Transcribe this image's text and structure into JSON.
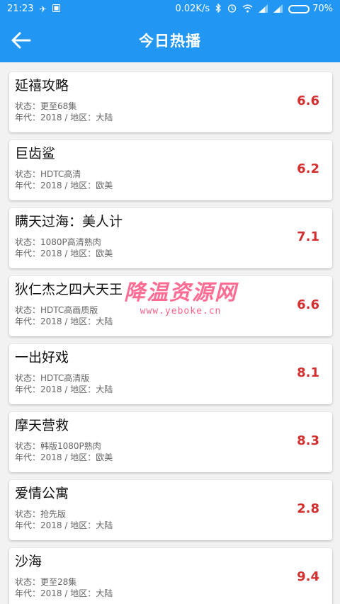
{
  "status_bar": {
    "time": "21:23",
    "speed": "0.02K/s",
    "battery": "70%",
    "battery_level": 0.7,
    "icons": [
      "airplane-icon",
      "notification-icon",
      "bluetooth-icon",
      "alarm-icon",
      "wifi-icon",
      "signal-icon",
      "signal-icon",
      "battery-icon"
    ]
  },
  "header": {
    "title": "今日热播",
    "back_icon": "arrow-left-icon"
  },
  "theme": {
    "primary": "#2196F3",
    "score_color": "#d32f2f"
  },
  "items": [
    {
      "name": "延禧攻略",
      "status": "状态：更至68集",
      "info": "年代：2018 / 地区：大陆",
      "score": "6.6"
    },
    {
      "name": "巨齿鲨",
      "status": "状态：HDTC高清",
      "info": "年代：2018 / 地区：欧美",
      "score": "6.2"
    },
    {
      "name": "瞒天过海：美人计",
      "status": "状态：1080P高清熟肉",
      "info": "年代：2018 / 地区：欧美",
      "score": "7.1"
    },
    {
      "name": "狄仁杰之四大天王",
      "status": "状态：HDTC高画质版",
      "info": "年代：2018 / 地区：大陆",
      "score": "6.6"
    },
    {
      "name": "一出好戏",
      "status": "状态：HDTC高清版",
      "info": "年代：2018 / 地区：大陆",
      "score": "8.1"
    },
    {
      "name": "摩天营救",
      "status": "状态：韩版1080P熟肉",
      "info": "年代：2018 / 地区：欧美",
      "score": "8.3"
    },
    {
      "name": "爱情公寓",
      "status": "状态：抢先版",
      "info": "年代：2018 / 地区：大陆",
      "score": "2.8"
    },
    {
      "name": "沙海",
      "status": "状态：更至28集",
      "info": "年代：2018 / 地区：大陆",
      "score": "9.4"
    }
  ],
  "watermark": {
    "main": "降温资源网",
    "url": "www.yeboke.cn"
  }
}
